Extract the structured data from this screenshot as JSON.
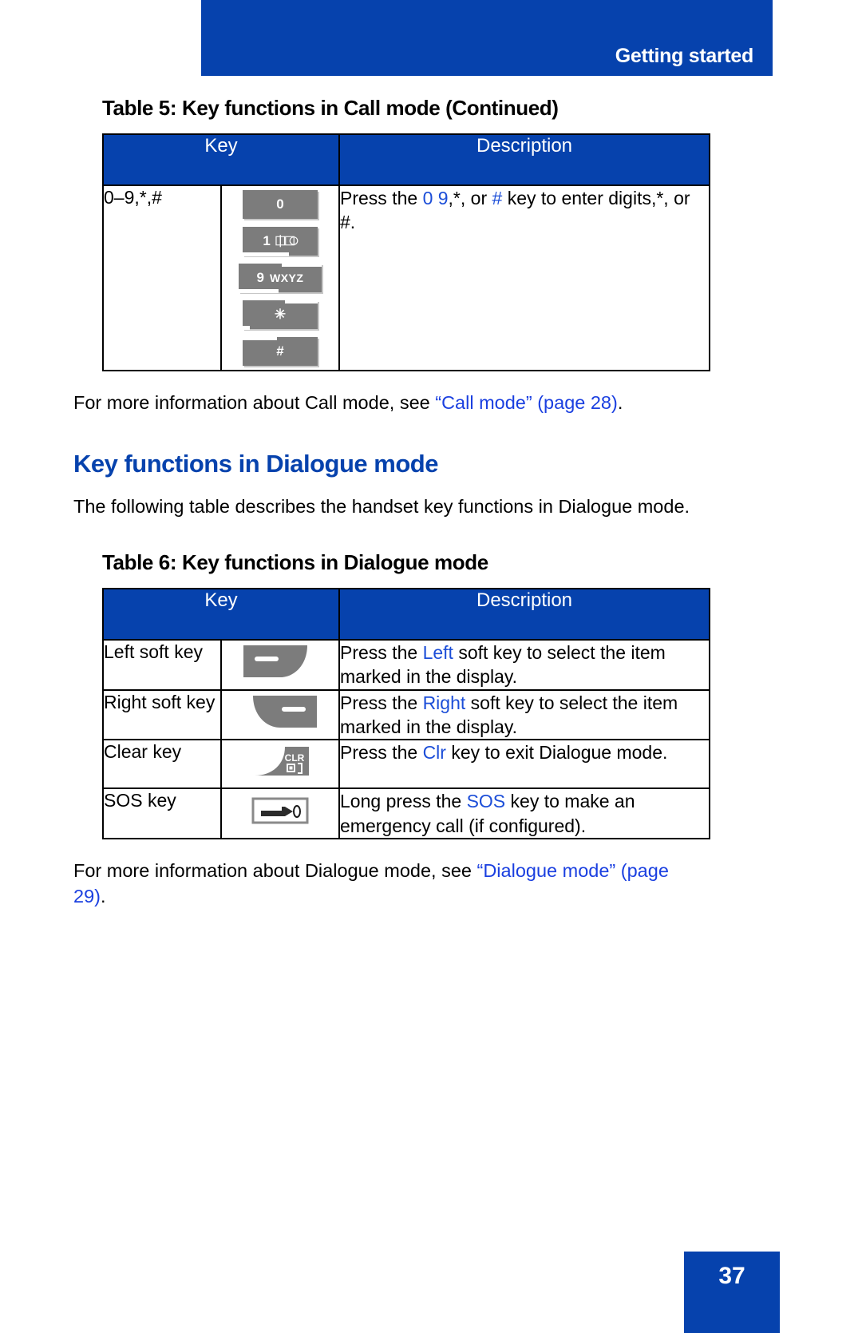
{
  "header": {
    "title": "Getting started"
  },
  "colors": {
    "brand_blue": "#0642AD",
    "link_blue": "#1a3fe0",
    "key_gray": "#7C7C7C"
  },
  "table5": {
    "caption": "Table 5: Key functions in Call mode (Continued)",
    "columns": [
      "Key",
      "Description"
    ],
    "rows": [
      {
        "key_label": "0–9,*,#",
        "keys": [
          {
            "name": "key-0",
            "digit": "0",
            "letters": ""
          },
          {
            "name": "key-1",
            "digit": "1",
            "letters": "∞"
          },
          {
            "name": "key-9",
            "digit": "9",
            "letters": "WXYZ"
          },
          {
            "name": "key-star",
            "digit": "✳",
            "letters": ""
          },
          {
            "name": "key-hash",
            "digit": "#",
            "letters": ""
          }
        ],
        "description_parts": [
          {
            "text": "Press the ",
            "color": "black"
          },
          {
            "text": "0",
            "color": "blue"
          },
          {
            "text": "  ",
            "color": "black"
          },
          {
            "text": "9",
            "color": "blue"
          },
          {
            "text": ",*, or ",
            "color": "black"
          },
          {
            "text": "#",
            "color": "blue"
          },
          {
            "text": " key to enter digits,*, or #.",
            "color": "black"
          }
        ]
      }
    ]
  },
  "para_call_mode": {
    "before": "For more information about Call mode, see ",
    "link": "“Call mode” (page 28)",
    "after": "."
  },
  "section": {
    "heading": "Key functions in Dialogue mode",
    "intro": "The following table describes the handset key functions in Dialogue mode."
  },
  "table6": {
    "caption": "Table 6: Key functions in Dialogue mode",
    "columns": [
      "Key",
      "Description"
    ],
    "rows": [
      {
        "key_label": "Left soft key",
        "icon": "left-soft-key-icon",
        "description_parts": [
          {
            "text": "Press the ",
            "color": "black"
          },
          {
            "text": "Left",
            "color": "blue"
          },
          {
            "text": " soft key to select the item marked in the display.",
            "color": "black"
          }
        ]
      },
      {
        "key_label": "Right soft key",
        "icon": "right-soft-key-icon",
        "description_parts": [
          {
            "text": "Press the ",
            "color": "black"
          },
          {
            "text": "Right",
            "color": "blue"
          },
          {
            "text": " soft key to select the item marked in the display.",
            "color": "black"
          }
        ]
      },
      {
        "key_label": "Clear key",
        "icon": "clear-key-icon",
        "icon_text": "CLR",
        "description_parts": [
          {
            "text": "Press the ",
            "color": "black"
          },
          {
            "text": "Clr",
            "color": "blue"
          },
          {
            "text": " key to exit Dialogue mode.",
            "color": "black"
          }
        ]
      },
      {
        "key_label": "SOS key",
        "icon": "sos-key-icon",
        "description_parts": [
          {
            "text": "Long press the ",
            "color": "black"
          },
          {
            "text": "SOS",
            "color": "blue"
          },
          {
            "text": " key to make an emergency call (if configured).",
            "color": "black"
          }
        ]
      }
    ]
  },
  "para_dialogue_mode": {
    "before": "For more information about Dialogue mode, see ",
    "link1": "“Dialogue mode”",
    "link2": "(page 29)",
    "after": "."
  },
  "footer": {
    "page_number": "37"
  }
}
